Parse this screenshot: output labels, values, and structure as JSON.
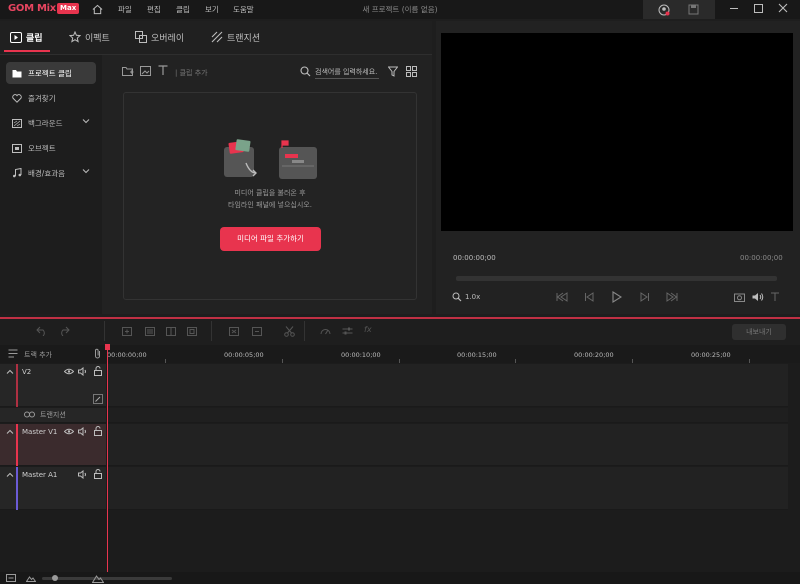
{
  "app": {
    "logo_text": "GOM Mix",
    "logo_badge": "Max",
    "menu": [
      "파일",
      "편집",
      "클립",
      "보기",
      "도움말"
    ],
    "window_title": "새 프로젝트 (이름 없음)"
  },
  "tabs": [
    {
      "label": "클립",
      "icon": "clip-icon",
      "active": true
    },
    {
      "label": "이펙트",
      "icon": "star-icon",
      "active": false
    },
    {
      "label": "오버레이",
      "icon": "overlay-icon",
      "active": false
    },
    {
      "label": "트랜지션",
      "icon": "transition-icon",
      "active": false
    }
  ],
  "sidebar": {
    "items": [
      {
        "label": "프로젝트 클립",
        "icon": "folder-icon",
        "active": true
      },
      {
        "label": "즐겨찾기",
        "icon": "heart-icon",
        "active": false
      },
      {
        "label": "백그라운드",
        "icon": "background-icon",
        "active": false,
        "expandable": true
      },
      {
        "label": "오브젝트",
        "icon": "object-icon",
        "active": false
      },
      {
        "label": "배경/효과음",
        "icon": "music-icon",
        "active": false,
        "expandable": true
      }
    ]
  },
  "clip_panel": {
    "add_clip_label": "| 클립 추가",
    "search_placeholder": "검색어를 입력하세요.",
    "drop_text_line1": "미디어 클립을 불러온 후",
    "drop_text_line2": "타임라인 패널에 넣으십시오.",
    "add_media_button": "미디어 파일 추가하기"
  },
  "preview": {
    "timecode_current": "00:00:00;00",
    "timecode_total": "00:00:00;00",
    "zoom": "1.0x"
  },
  "timeline": {
    "export_button": "내보내기",
    "track_add_label": "트랙 추가",
    "ruler": [
      "00:00:00;00",
      "00:00:05;00",
      "00:00:10;00",
      "00:00:15;00",
      "00:00:20;00",
      "00:00:25;00"
    ],
    "tracks": {
      "v2": "V2",
      "transition": "트랜지션",
      "master_v1": "Master V1",
      "master_a1": "Master A1"
    }
  },
  "colors": {
    "accent": "#e8344e",
    "background": "#1e1e1e",
    "panel": "#222222"
  }
}
